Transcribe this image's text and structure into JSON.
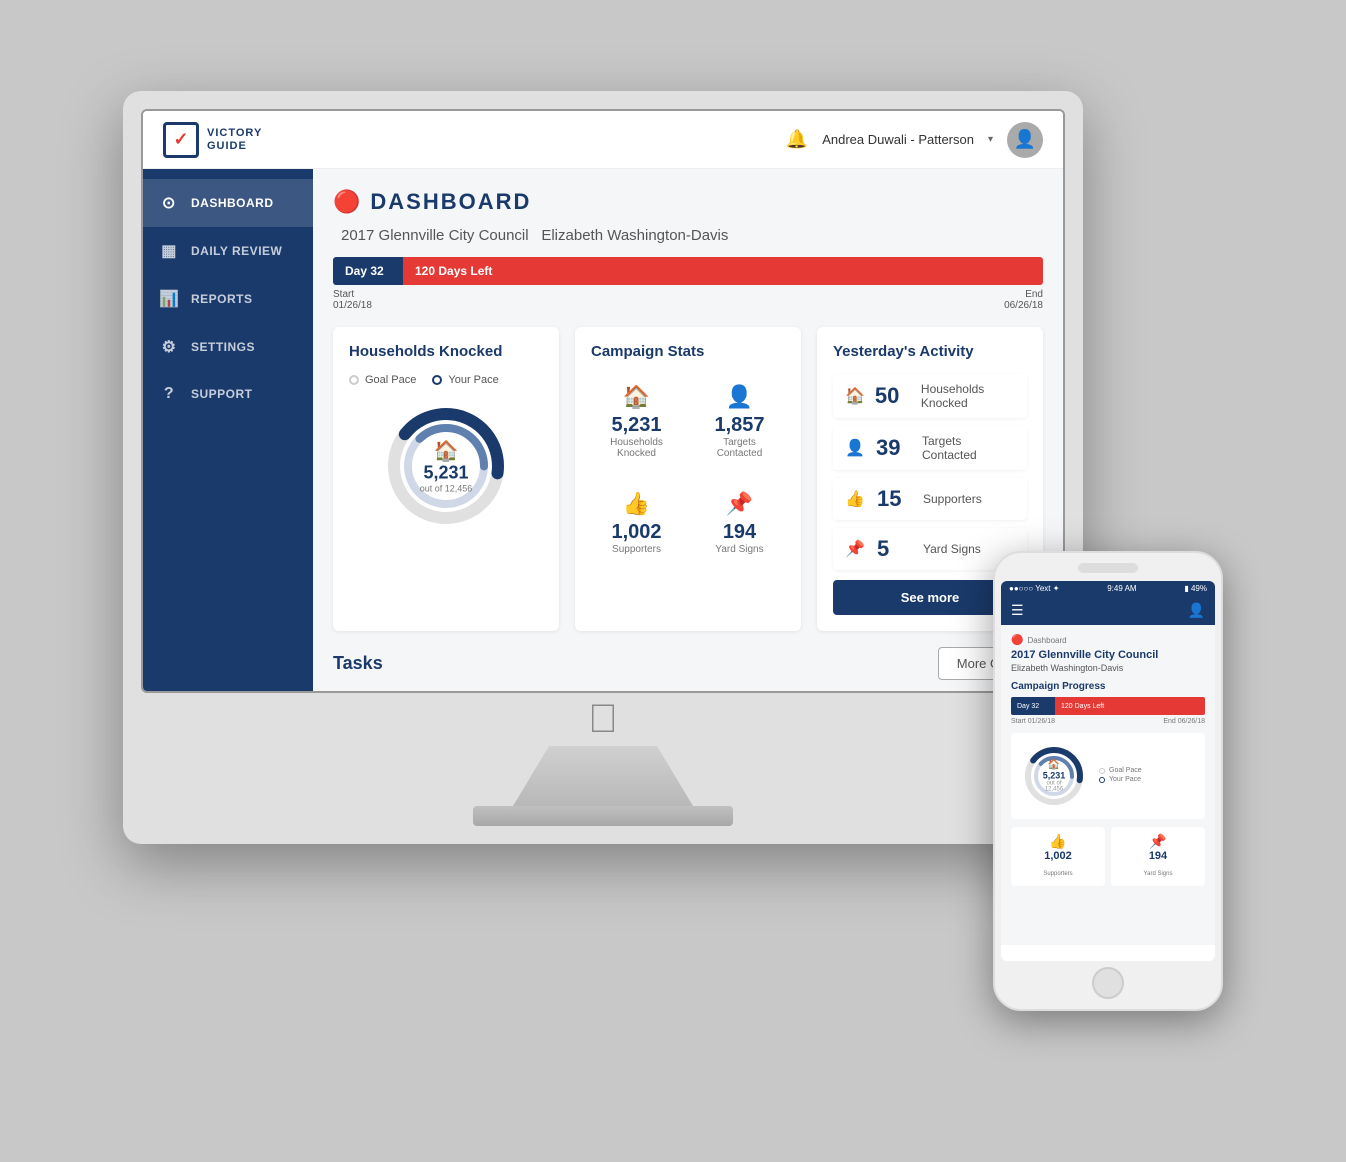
{
  "logo": {
    "line1": "VICTORY",
    "line2": "GUIDE"
  },
  "header": {
    "user_name": "Andrea Duwali - Patterson",
    "bell_icon": "🔔",
    "chevron": "▾"
  },
  "sidebar": {
    "items": [
      {
        "id": "dashboard",
        "label": "DASHBOARD",
        "icon": "⊙",
        "active": true
      },
      {
        "id": "daily-review",
        "label": "DAILY REVIEW",
        "icon": "▦",
        "active": false
      },
      {
        "id": "reports",
        "label": "REPORTS",
        "icon": "📊",
        "active": false
      },
      {
        "id": "settings",
        "label": "SETTINGS",
        "icon": "⚙",
        "active": false
      },
      {
        "id": "support",
        "label": "SUPPORT",
        "icon": "?",
        "active": false
      }
    ]
  },
  "main": {
    "page_title": "DASHBOARD",
    "campaign_name": "2017 Glennville City Council",
    "campaign_subtitle": "Elizabeth Washington-Davis",
    "progress": {
      "day_label": "Day 32",
      "days_left_label": "120 Days Left",
      "start_label": "Start",
      "start_date": "01/26/18",
      "end_label": "End",
      "end_date": "06/26/18"
    },
    "households_knocked": {
      "section_title": "Households Knocked",
      "legend": {
        "goal_label": "Goal Pace",
        "pace_label": "Your Pace"
      },
      "donut": {
        "number": "5,231",
        "sub_label": "out of 12,456",
        "goal_percent": 42,
        "pace_percent": 42
      }
    },
    "campaign_stats": {
      "section_title": "Campaign Stats",
      "items": [
        {
          "id": "hh-knocked",
          "icon": "🏠",
          "number": "5,231",
          "label": "Households Knocked"
        },
        {
          "id": "targets",
          "icon": "👤",
          "number": "1,857",
          "label": "Targets Contacted"
        },
        {
          "id": "supporters",
          "icon": "👍",
          "number": "1,002",
          "label": "Supporters"
        },
        {
          "id": "yard-signs",
          "icon": "📌",
          "number": "194",
          "label": "Yard Signs"
        }
      ]
    },
    "yesterday_activity": {
      "section_title": "Yesterday's Activity",
      "items": [
        {
          "id": "hh",
          "icon": "🏠",
          "number": "50",
          "label": "Households Knocked"
        },
        {
          "id": "targets",
          "icon": "👤",
          "number": "39",
          "label": "Targets Contacted"
        },
        {
          "id": "supporters",
          "icon": "👍",
          "number": "15",
          "label": "Supporters"
        },
        {
          "id": "yard-signs",
          "icon": "📌",
          "number": "5",
          "label": "Yard Signs"
        }
      ],
      "see_more_label": "See more"
    },
    "tasks": {
      "title": "Tasks",
      "more_goals_label": "More Goals"
    }
  },
  "phone": {
    "status_bar": {
      "carrier": "●●○○○ Yext ✦",
      "time": "9:49 AM",
      "battery": "▮ 49%"
    },
    "nav": {
      "hamburger": "☰",
      "user": "👤"
    },
    "section_label": "Dashboard",
    "campaign_title": "2017 Glennville City Council",
    "campaign_sub": "Elizabeth Washington-Davis",
    "section_header": "Campaign Progress",
    "progress": {
      "day_label": "Day 32",
      "days_left_label": "120 Days Left",
      "start_label": "Start",
      "start_date": "01/26/18",
      "end_label": "End",
      "end_date": "06/26/18"
    },
    "donut": {
      "number": "5,231",
      "sub_label": "out of 12,456",
      "legend": {
        "goal_label": "Goal Pace",
        "pace_label": "Your Pace"
      }
    },
    "stats": [
      {
        "icon": "👍",
        "number": "1,002",
        "label": "Supporters"
      },
      {
        "icon": "📌",
        "number": "194",
        "label": "Yard Signs"
      }
    ]
  }
}
